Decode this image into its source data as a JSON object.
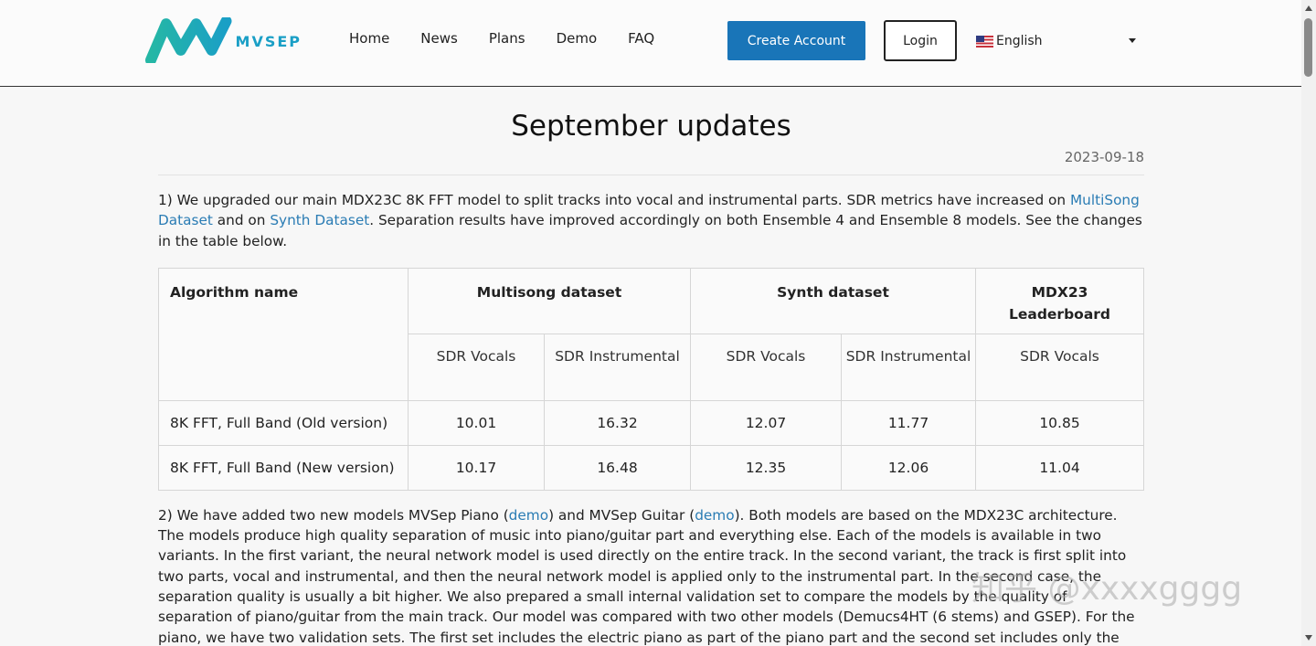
{
  "header": {
    "logo_text": "MVSEP",
    "nav": [
      "Home",
      "News",
      "Plans",
      "Demo",
      "FAQ"
    ],
    "create_account": "Create Account",
    "login": "Login",
    "language": "English"
  },
  "article": {
    "title": "September updates",
    "date": "2023-09-18",
    "para1": {
      "t1": "1) We upgraded our main MDX23C 8K FFT model to split tracks into vocal and instrumental parts. SDR metrics have increased on ",
      "link1": "MultiSong Dataset",
      "t2": " and on ",
      "link2": "Synth Dataset",
      "t3": ". Separation results have improved accordingly on both Ensemble 4 and Ensemble 8 models. See the changes in the table below."
    },
    "table": {
      "col_algorithm": "Algorithm name",
      "col_multisong": "Multisong dataset",
      "col_synth": "Synth dataset",
      "col_mdx23": "MDX23 Leaderboard",
      "sub": [
        "SDR Vocals",
        "SDR Instrumental",
        "SDR Vocals",
        "SDR Instrumental",
        "SDR Vocals"
      ],
      "rows": [
        {
          "name": "8K FFT, Full Band (Old version)",
          "values": [
            "10.01",
            "16.32",
            "12.07",
            "11.77",
            "10.85"
          ]
        },
        {
          "name": "8K FFT, Full Band (New version)",
          "values": [
            "10.17",
            "16.48",
            "12.35",
            "12.06",
            "11.04"
          ]
        }
      ]
    },
    "para2": {
      "t1": "2) We have added two new models MVSep Piano (",
      "link1": "demo",
      "t2": ") and MVSep Guitar (",
      "link2": "demo",
      "t3": "). Both models are based on the MDX23C architecture. The models produce high quality separation of music into piano/guitar part and everything else. Each of the models is available in two variants. In the first variant, the neural network model is used directly on the entire track. In the second variant, the track is first split into two parts, vocal and instrumental, and then the neural network model is applied only to the instrumental part. In the second case, the separation quality is usually a bit higher. We also prepared a small internal validation set to compare the models by the quality of separation of piano/guitar from the main track. Our model was compared with two other models (Demucs4HT (6 stems) and GSEP). For the piano, we have two validation sets. The first set includes the electric piano as part of the piano part and the second set includes only the acoustic piano."
    }
  },
  "watermark": "知乎 @xxxxgggg",
  "colors": {
    "accent": "#1975b8",
    "link": "#2a7cb4",
    "logo": "#1a9fc6"
  }
}
